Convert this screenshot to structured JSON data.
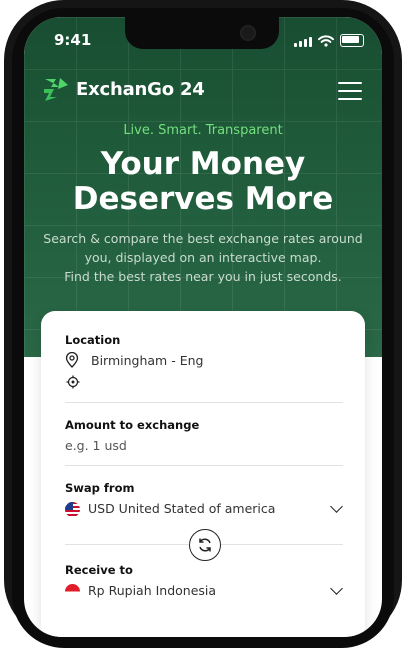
{
  "status_bar": {
    "time": "9:41"
  },
  "header": {
    "brand": "ExchanGo 24"
  },
  "hero": {
    "tagline": "Live. Smart. Transparent",
    "headline_line1": "Your Money",
    "headline_line2": "Deserves More",
    "sub_line1": "Search & compare the best exchange rates around",
    "sub_line2": "you, displayed on an interactive map.",
    "sub_line3": "Find the best rates near you in just seconds."
  },
  "form": {
    "location_label": "Location",
    "location_value": "Birmingham - Eng",
    "amount_label": "Amount to exchange",
    "amount_placeholder": "e.g. 1 usd",
    "swap_from_label": "Swap from",
    "swap_from_value": "USD United Stated of america",
    "receive_label": "Receive to",
    "receive_value": "Rp Rupiah Indonesia"
  },
  "colors": {
    "hero_green": "#1f5b3a",
    "accent_green": "#73e07e"
  }
}
